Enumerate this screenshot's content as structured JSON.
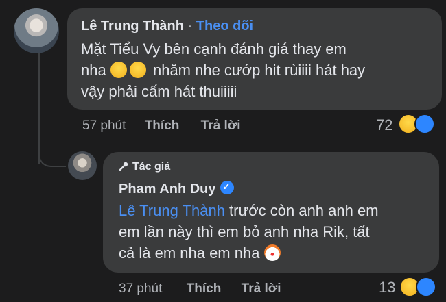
{
  "comment1": {
    "author": "Lê Trung Thành",
    "separator": "·",
    "follow_label": "Theo dõi",
    "text_line1": "Mặt Tiểu Vy bên cạnh đánh giá thay em",
    "text_line2_pre": "nha",
    "text_line2_post": "nhăm nhe cướp hit rùiiii hát hay",
    "text_line3": "vậy phải cấm hát thuiiiii",
    "time": "57 phút",
    "like_label": "Thích",
    "reply_label": "Trả lời",
    "reaction_count": "72",
    "reactions": [
      "laughing-emoji",
      "like-icon"
    ]
  },
  "comment2": {
    "author_tag": "Tác giả",
    "author": "Pham Anh Duy",
    "verified": true,
    "mention": "Lê Trung Thành",
    "text_line1_post": " trước còn anh anh em",
    "text_line2": "em lần này thì em bỏ anh nha Rik, tất",
    "text_line3": "cả là em nha em nha",
    "time": "37 phút",
    "like_label": "Thích",
    "reply_label": "Trả lời",
    "reaction_count": "13",
    "reactions": [
      "laughing-emoji",
      "like-icon"
    ]
  },
  "colors": {
    "background": "#1c1c1d",
    "bubble": "#3a3b3c",
    "link": "#4a8ff2",
    "like": "#2d86ff",
    "muted": "#b0b3b8"
  }
}
